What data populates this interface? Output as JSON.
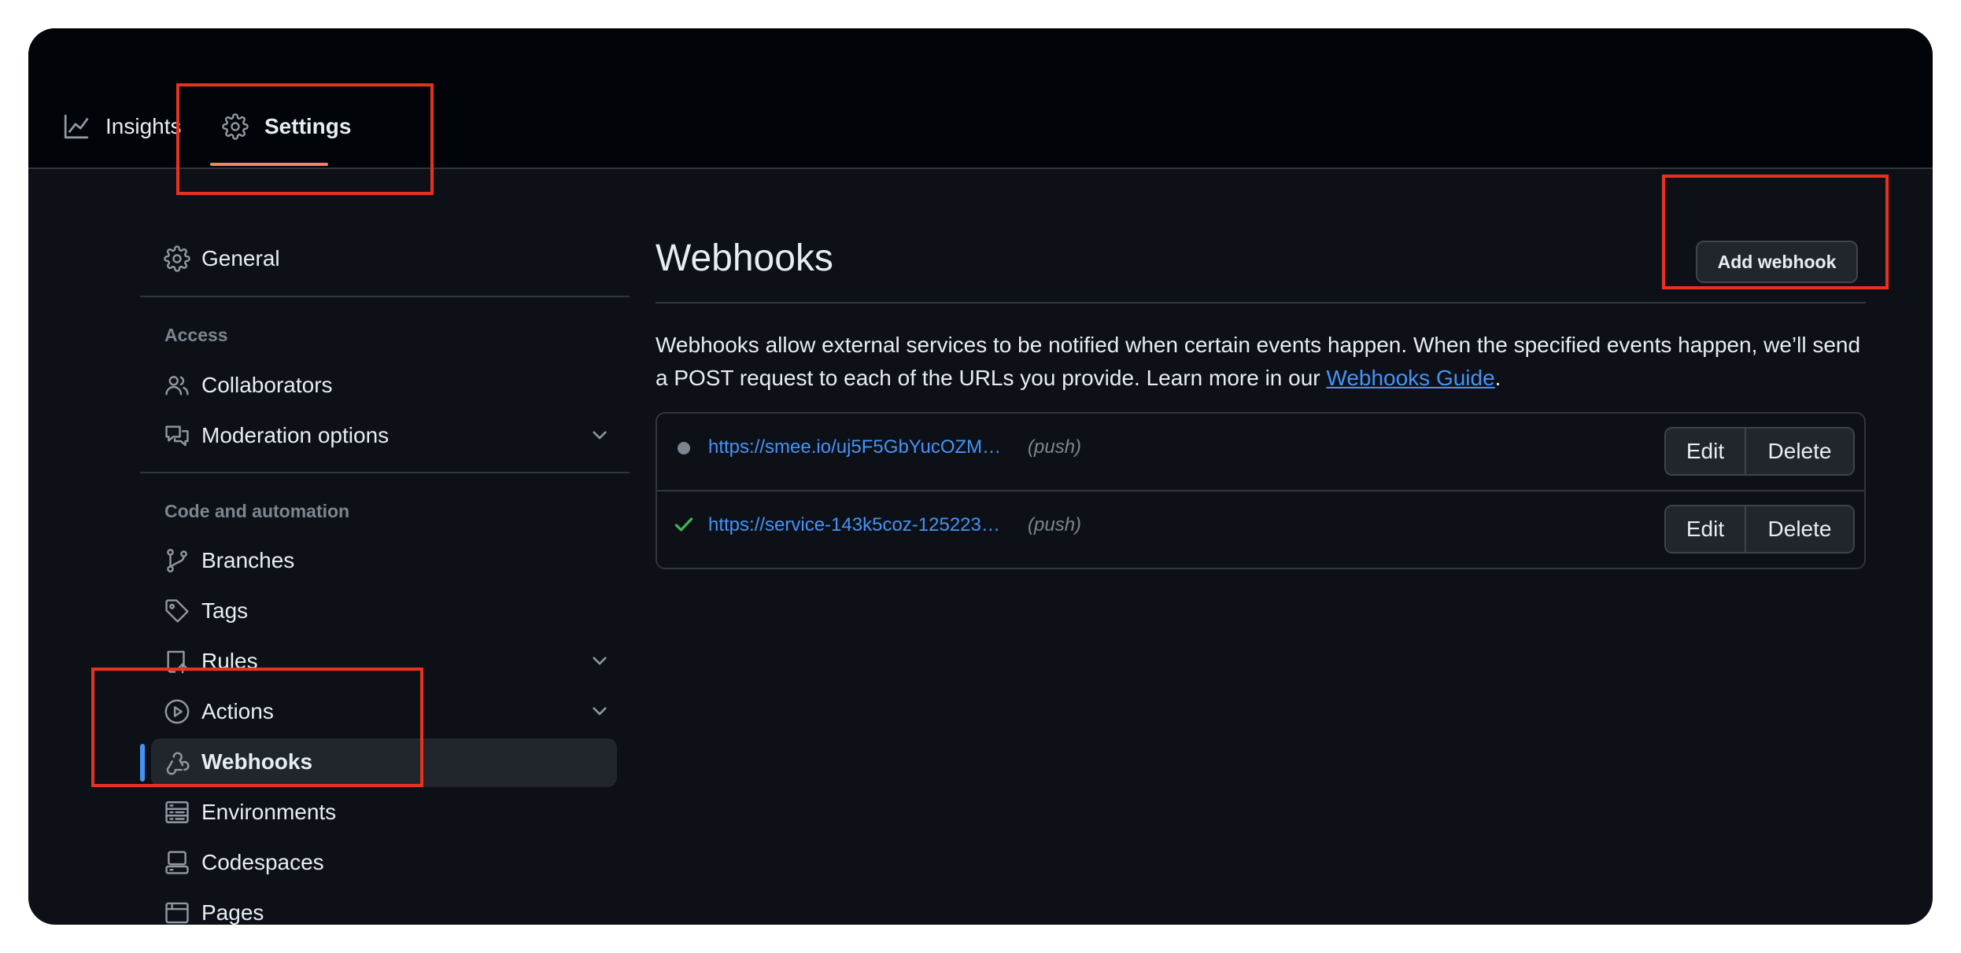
{
  "topnav": {
    "tabs": [
      {
        "label": "Insights",
        "icon": "graph-icon"
      },
      {
        "label": "Settings",
        "icon": "gear-icon",
        "selected": true
      }
    ]
  },
  "sidebar": {
    "general": {
      "label": "General",
      "icon": "gear-icon"
    },
    "sections": [
      {
        "heading": "Access",
        "items": [
          {
            "label": "Collaborators",
            "icon": "people-icon"
          },
          {
            "label": "Moderation options",
            "icon": "comment-discussion-icon",
            "expandable": true
          }
        ]
      },
      {
        "heading": "Code and automation",
        "items": [
          {
            "label": "Branches",
            "icon": "git-branch-icon"
          },
          {
            "label": "Tags",
            "icon": "tag-icon"
          },
          {
            "label": "Rules",
            "icon": "repo-push-icon",
            "expandable": true
          },
          {
            "label": "Actions",
            "icon": "play-icon",
            "expandable": true
          },
          {
            "label": "Webhooks",
            "icon": "webhook-icon",
            "active": true
          },
          {
            "label": "Environments",
            "icon": "server-icon"
          },
          {
            "label": "Codespaces",
            "icon": "codespaces-icon"
          },
          {
            "label": "Pages",
            "icon": "browser-icon"
          }
        ]
      }
    ]
  },
  "main": {
    "title": "Webhooks",
    "add_button": "Add webhook",
    "description": "Webhooks allow external services to be notified when certain events happen. When the specified events happen, we’ll send a POST request to each of the URLs you provide. Learn more in our ",
    "guide_link": "Webhooks Guide",
    "description_end": ".",
    "webhooks": [
      {
        "url": "https://smee.io/uj5F5GbYucOZM…",
        "event": "(push)",
        "status": "neutral",
        "edit": "Edit",
        "delete": "Delete"
      },
      {
        "url": "https://service-143k5coz-125223…",
        "event": "(push)",
        "status": "success",
        "edit": "Edit",
        "delete": "Delete"
      }
    ]
  },
  "colors": {
    "background": "#0d1117",
    "topbar": "#010409",
    "accent_underline": "#f78166",
    "link": "#4493f8",
    "success": "#3fb950",
    "highlight_box": "#e8321e"
  }
}
